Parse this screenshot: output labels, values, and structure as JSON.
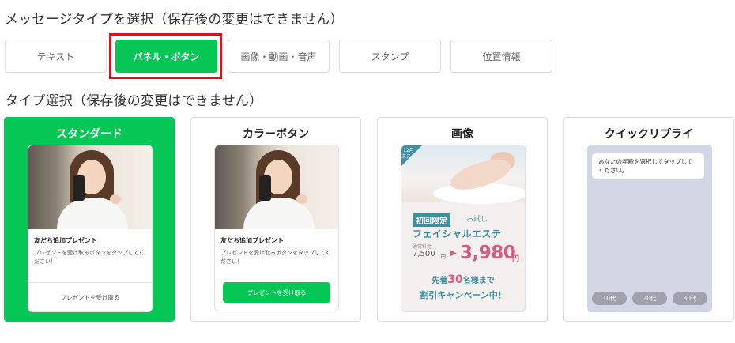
{
  "heading_message_type": "メッセージタイプを選択（保存後の変更はできません）",
  "heading_type_select": "タイプ選択（保存後の変更はできません）",
  "message_tabs": [
    {
      "label": "テキスト",
      "active": false
    },
    {
      "label": "パネル・ボタン",
      "active": true
    },
    {
      "label": "画像・動画・音声",
      "active": false
    },
    {
      "label": "スタンプ",
      "active": false
    },
    {
      "label": "位置情報",
      "active": false
    }
  ],
  "types": {
    "standard": {
      "title": "スタンダード",
      "card_heading": "友だち追加プレゼント",
      "card_text": "プレゼントを受け取るボタンをタップしてください！",
      "action_label": "プレゼントを受け取る"
    },
    "color_button": {
      "title": "カラーボタン",
      "card_heading": "友だち追加プレゼント",
      "card_text": "プレゼントを受け取るボタンをタップしてください！",
      "action_label": "プレゼントを受け取る"
    },
    "image": {
      "title": "画像",
      "badge": "12月末まで",
      "tag": "初回限定",
      "trial": "お試し",
      "service": "フェイシャルエステ",
      "regular_label": "通常料金",
      "old_price": "7,500",
      "old_unit": "円",
      "new_price": "3,980",
      "new_unit": "円",
      "first_prefix": "先着",
      "first_count": "30",
      "first_suffix": "名様まで",
      "campaign": "割引キャンペーン中！"
    },
    "quick_reply": {
      "title": "クイックリプライ",
      "bubble_text": "あなたの年齢を選択してタップしてください。",
      "chips": [
        "10代",
        "20代",
        "30代"
      ]
    }
  },
  "colors": {
    "accent": "#06c755",
    "highlight_border": "#d4131a",
    "promo_teal": "#3f8fa0",
    "promo_pink": "#d65a82",
    "quick_bg": "#d3d6e4"
  }
}
